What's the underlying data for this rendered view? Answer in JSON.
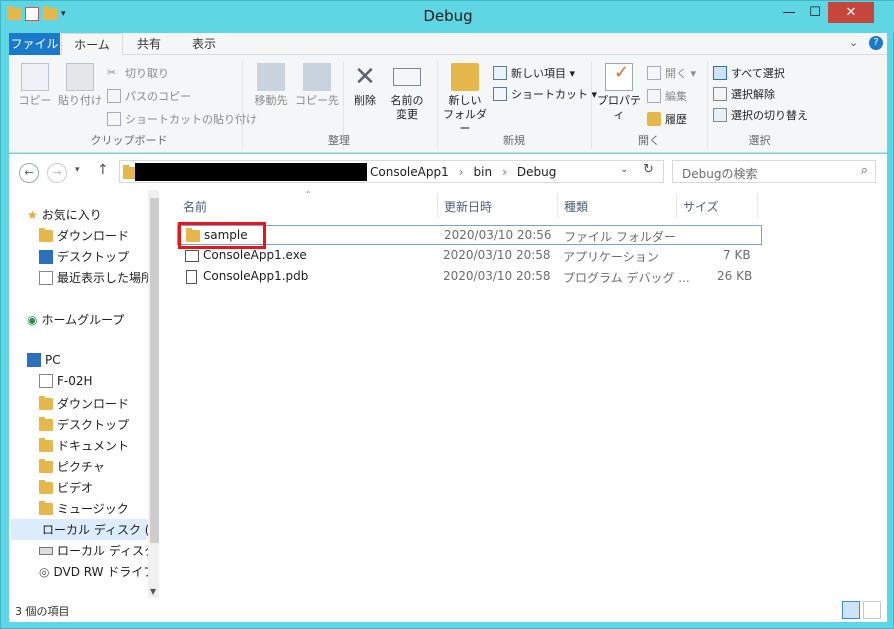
{
  "window": {
    "title": "Debug"
  },
  "ribbon": {
    "tabs": [
      "ファイル",
      "ホーム",
      "共有",
      "表示"
    ],
    "clipboard": {
      "copy": "コピー",
      "paste": "貼り付け",
      "cut": "切り取り",
      "copy_path": "パスのコピー",
      "paste_shortcut": "ショートカットの貼り付け",
      "label": "クリップボード"
    },
    "organize": {
      "move_to": "移動先",
      "copy_to": "コピー先",
      "delete": "削除",
      "rename_1": "名前の",
      "rename_2": "変更",
      "label": "整理"
    },
    "new": {
      "new_folder_1": "新しい",
      "new_folder_2": "フォルダー",
      "new_item": "新しい項目 ▾",
      "shortcut": "ショートカット ▾",
      "label": "新規"
    },
    "open": {
      "properties": "プロパティ",
      "open": "開く ▾",
      "edit": "編集",
      "history": "履歴",
      "label": "開く"
    },
    "select": {
      "select_all": "すべて選択",
      "select_none": "選択解除",
      "invert": "選択の切り替え",
      "label": "選択"
    }
  },
  "address": {
    "crumbs": [
      "ConsoleApp1",
      "bin",
      "Debug"
    ],
    "search_placeholder": "Debugの検索"
  },
  "nav": {
    "favorites": "お気に入り",
    "fav_items": [
      "ダウンロード",
      "デスクトップ",
      "最近表示した場所"
    ],
    "homegroup": "ホームグループ",
    "pc": "PC",
    "pc_items": [
      "F-02H",
      "ダウンロード",
      "デスクトップ",
      "ドキュメント",
      "ピクチャ",
      "ビデオ",
      "ミュージック",
      "ローカル ディスク (C",
      "ローカル ディスク (",
      "DVD RW ドライブ"
    ]
  },
  "columns": {
    "name": "名前",
    "modified": "更新日時",
    "type": "種類",
    "size": "サイズ"
  },
  "files": [
    {
      "name": "sample",
      "modified": "2020/03/10 20:56",
      "type": "ファイル フォルダー",
      "size": ""
    },
    {
      "name": "ConsoleApp1.exe",
      "modified": "2020/03/10 20:58",
      "type": "アプリケーション",
      "size": "7 KB"
    },
    {
      "name": "ConsoleApp1.pdb",
      "modified": "2020/03/10 20:58",
      "type": "プログラム デバッグ ...",
      "size": "26 KB"
    }
  ],
  "status": {
    "count": "3 個の項目"
  },
  "colors": {
    "accent": "#1979ca",
    "titlebar": "#5ed6e3",
    "close": "#c7463c",
    "highlight": "#e8151a"
  }
}
